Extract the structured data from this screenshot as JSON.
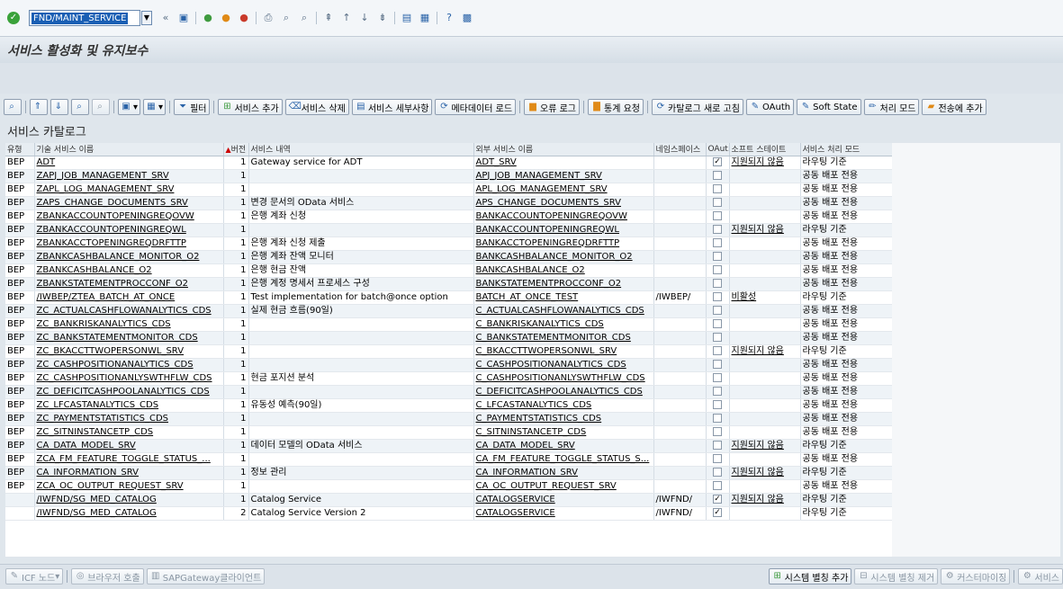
{
  "command_field": {
    "value": "FND/MAINT_SERVICE"
  },
  "title": "서비스 활성화 및 유지보수",
  "toolbar": {
    "filter": "필터",
    "add_service": "서비스 추가",
    "delete_service": "서비스 삭제",
    "service_details": "서비스 세부사항",
    "load_metadata": "메타데이터 로드",
    "error_log": "오류 로그",
    "call_stats": "통계 요청",
    "refresh_catalog": "카탈로그 새로 고침",
    "oauth": "OAuth",
    "soft_state": "Soft State",
    "processing_mode": "처리 모드",
    "add_to_transport": "전송에 추가"
  },
  "section_title": "서비스 카탈로그",
  "columns": [
    "유형",
    "기술 서비스 이름",
    "버전",
    "서비스 내역",
    "외부 서비스 이름",
    "네임스페이스",
    "OAut...",
    "소프트 스테이트",
    "서비스 처리 모드"
  ],
  "rows": [
    {
      "type": "BEP",
      "tech": "ADT",
      "ver": "1",
      "desc": "Gateway service for ADT",
      "ext": "ADT_SRV",
      "ns": "",
      "oauth": true,
      "soft": "지원되지 않음",
      "mode": "라우팅 기준"
    },
    {
      "type": "BEP",
      "tech": "ZAPJ_JOB_MANAGEMENT_SRV",
      "ver": "1",
      "desc": "",
      "ext": "APJ_JOB_MANAGEMENT_SRV",
      "ns": "",
      "oauth": false,
      "soft": "",
      "mode": "공동 배포 전용"
    },
    {
      "type": "BEP",
      "tech": "ZAPL_LOG_MANAGEMENT_SRV",
      "ver": "1",
      "desc": "",
      "ext": "APL_LOG_MANAGEMENT_SRV",
      "ns": "",
      "oauth": false,
      "soft": "",
      "mode": "공동 배포 전용"
    },
    {
      "type": "BEP",
      "tech": "ZAPS_CHANGE_DOCUMENTS_SRV",
      "ver": "1",
      "desc": "변경 문서의 OData 서비스",
      "ext": "APS_CHANGE_DOCUMENTS_SRV",
      "ns": "",
      "oauth": false,
      "soft": "",
      "mode": "공동 배포 전용"
    },
    {
      "type": "BEP",
      "tech": "ZBANKACCOUNTOPENINGREQOVW",
      "ver": "1",
      "desc": "은행 계좌 신청",
      "ext": "BANKACCOUNTOPENINGREQOVW",
      "ns": "",
      "oauth": false,
      "soft": "",
      "mode": "공동 배포 전용"
    },
    {
      "type": "BEP",
      "tech": "ZBANKACCOUNTOPENINGREQWL",
      "ver": "1",
      "desc": "",
      "ext": "BANKACCOUNTOPENINGREQWL",
      "ns": "",
      "oauth": false,
      "soft": "지원되지 않음",
      "mode": "라우팅 기준"
    },
    {
      "type": "BEP",
      "tech": "ZBANKACCTOPENINGREQDRFTTP",
      "ver": "1",
      "desc": "은행 계좌 신청 제출",
      "ext": "BANKACCTOPENINGREQDRFTTP",
      "ns": "",
      "oauth": false,
      "soft": "",
      "mode": "공동 배포 전용"
    },
    {
      "type": "BEP",
      "tech": "ZBANKCASHBALANCE_MONITOR_O2",
      "ver": "1",
      "desc": "은행 계좌 잔액 모니터",
      "ext": "BANKCASHBALANCE_MONITOR_O2",
      "ns": "",
      "oauth": false,
      "soft": "",
      "mode": "공동 배포 전용"
    },
    {
      "type": "BEP",
      "tech": "ZBANKCASHBALANCE_O2",
      "ver": "1",
      "desc": "은행 현금 잔액",
      "ext": "BANKCASHBALANCE_O2",
      "ns": "",
      "oauth": false,
      "soft": "",
      "mode": "공동 배포 전용"
    },
    {
      "type": "BEP",
      "tech": "ZBANKSTATEMENTPROCCONF_O2",
      "ver": "1",
      "desc": "은행 계정 명세서 프로세스 구성",
      "ext": "BANKSTATEMENTPROCCONF_O2",
      "ns": "",
      "oauth": false,
      "soft": "",
      "mode": "공동 배포 전용"
    },
    {
      "type": "BEP",
      "tech": "/IWBEP/ZTEA_BATCH_AT_ONCE",
      "ver": "1",
      "desc": "Test implementation for batch@once option",
      "ext": "BATCH_AT_ONCE_TEST",
      "ns": "/IWBEP/",
      "oauth": false,
      "soft": "비활성",
      "mode": "라우팅 기준"
    },
    {
      "type": "BEP",
      "tech": "ZC_ACTUALCASHFLOWANALYTICS_CDS",
      "ver": "1",
      "desc": "실제 현금 흐름(90일)",
      "ext": "C_ACTUALCASHFLOWANALYTICS_CDS",
      "ns": "",
      "oauth": false,
      "soft": "",
      "mode": "공동 배포 전용"
    },
    {
      "type": "BEP",
      "tech": "ZC_BANKRISKANALYTICS_CDS",
      "ver": "1",
      "desc": "",
      "ext": "C_BANKRISKANALYTICS_CDS",
      "ns": "",
      "oauth": false,
      "soft": "",
      "mode": "공동 배포 전용"
    },
    {
      "type": "BEP",
      "tech": "ZC_BANKSTATEMENTMONITOR_CDS",
      "ver": "1",
      "desc": "",
      "ext": "C_BANKSTATEMENTMONITOR_CDS",
      "ns": "",
      "oauth": false,
      "soft": "",
      "mode": "공동 배포 전용"
    },
    {
      "type": "BEP",
      "tech": "ZC_BKACCTTWOPERSONWL_SRV",
      "ver": "1",
      "desc": "",
      "ext": "C_BKACCTTWOPERSONWL_SRV",
      "ns": "",
      "oauth": false,
      "soft": "지원되지 않음",
      "mode": "라우팅 기준"
    },
    {
      "type": "BEP",
      "tech": "ZC_CASHPOSITIONANALYTICS_CDS",
      "ver": "1",
      "desc": "",
      "ext": "C_CASHPOSITIONANALYTICS_CDS",
      "ns": "",
      "oauth": false,
      "soft": "",
      "mode": "공동 배포 전용"
    },
    {
      "type": "BEP",
      "tech": "ZC_CASHPOSITIONANLYSWTHFLW_CDS",
      "ver": "1",
      "desc": "현금 포지션 분석",
      "ext": "C_CASHPOSITIONANLYSWTHFLW_CDS",
      "ns": "",
      "oauth": false,
      "soft": "",
      "mode": "공동 배포 전용"
    },
    {
      "type": "BEP",
      "tech": "ZC_DEFICITCASHPOOLANALYTICS_CDS",
      "ver": "1",
      "desc": "",
      "ext": "C_DEFICITCASHPOOLANALYTICS_CDS",
      "ns": "",
      "oauth": false,
      "soft": "",
      "mode": "공동 배포 전용"
    },
    {
      "type": "BEP",
      "tech": "ZC_LFCASTANALYTICS_CDS",
      "ver": "1",
      "desc": "유동성 예측(90일)",
      "ext": "C_LFCASTANALYTICS_CDS",
      "ns": "",
      "oauth": false,
      "soft": "",
      "mode": "공동 배포 전용"
    },
    {
      "type": "BEP",
      "tech": "ZC_PAYMENTSTATISTICS_CDS",
      "ver": "1",
      "desc": "",
      "ext": "C_PAYMENTSTATISTICS_CDS",
      "ns": "",
      "oauth": false,
      "soft": "",
      "mode": "공동 배포 전용"
    },
    {
      "type": "BEP",
      "tech": "ZC_SITNINSTANCETP_CDS",
      "ver": "1",
      "desc": "",
      "ext": "C_SITNINSTANCETP_CDS",
      "ns": "",
      "oauth": false,
      "soft": "",
      "mode": "공동 배포 전용"
    },
    {
      "type": "BEP",
      "tech": "CA_DATA_MODEL_SRV",
      "ver": "1",
      "desc": "데이터 모델의 OData 서비스",
      "ext": "CA_DATA_MODEL_SRV",
      "ns": "",
      "oauth": false,
      "soft": "지원되지 않음",
      "mode": "라우팅 기준"
    },
    {
      "type": "BEP",
      "tech": "ZCA_FM_FEATURE_TOGGLE_STATUS_...",
      "ver": "1",
      "desc": "",
      "ext": "CA_FM_FEATURE_TOGGLE_STATUS_S...",
      "ns": "",
      "oauth": false,
      "soft": "",
      "mode": "공동 배포 전용"
    },
    {
      "type": "BEP",
      "tech": "CA_INFORMATION_SRV",
      "ver": "1",
      "desc": "정보 관리",
      "ext": "CA_INFORMATION_SRV",
      "ns": "",
      "oauth": false,
      "soft": "지원되지 않음",
      "mode": "라우팅 기준"
    },
    {
      "type": "BEP",
      "tech": "ZCA_OC_OUTPUT_REQUEST_SRV",
      "ver": "1",
      "desc": "",
      "ext": "CA_OC_OUTPUT_REQUEST_SRV",
      "ns": "",
      "oauth": false,
      "soft": "",
      "mode": "공동 배포 전용"
    },
    {
      "type": "",
      "tech": "/IWFND/SG_MED_CATALOG",
      "ver": "1",
      "desc": "Catalog Service",
      "ext": "CATALOGSERVICE",
      "ns": "/IWFND/",
      "oauth": true,
      "soft": "지원되지 않음",
      "mode": "라우팅 기준"
    },
    {
      "type": "",
      "tech": "/IWFND/SG_MED_CATALOG",
      "ver": "2",
      "desc": "Catalog Service Version 2",
      "ext": "CATALOGSERVICE",
      "ns": "/IWFND/",
      "oauth": true,
      "soft": "",
      "mode": "라우팅 기준"
    }
  ],
  "bottom_left": {
    "icf_node": "ICF 노드",
    "browser_call": "브라우저 호출",
    "gateway_client": "SAPGateway클라이언트"
  },
  "bottom_right": {
    "add_alias": "시스템 별칭 추가",
    "remove_alias": "시스템 별칭 제거",
    "customize": "커스터마이징",
    "service": "서비스"
  },
  "colors": {
    "selection": "#1a5fb4",
    "stripe": "#eef3f7",
    "background": "#dfe6ec"
  }
}
